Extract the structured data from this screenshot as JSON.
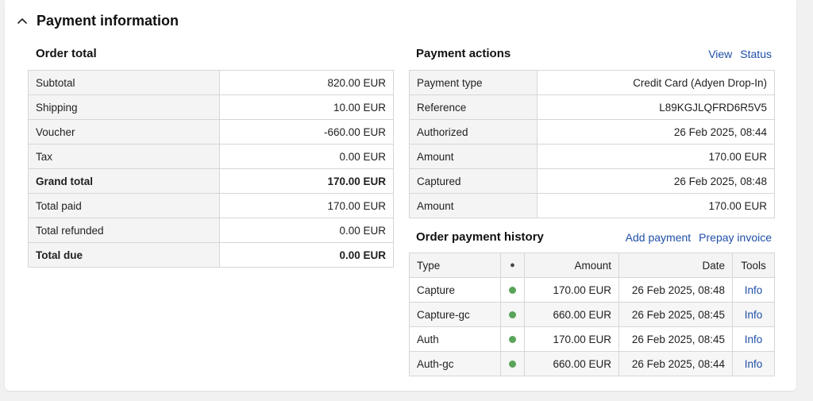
{
  "section": {
    "title": "Payment information",
    "header_dot": "●"
  },
  "order_total": {
    "title": "Order total",
    "rows": [
      {
        "label": "Subtotal",
        "value": "820.00 EUR",
        "bold": false
      },
      {
        "label": "Shipping",
        "value": "10.00 EUR",
        "bold": false
      },
      {
        "label": "Voucher",
        "value": "-660.00 EUR",
        "bold": false
      },
      {
        "label": "Tax",
        "value": "0.00 EUR",
        "bold": false
      },
      {
        "label": "Grand total",
        "value": "170.00 EUR",
        "bold": true
      },
      {
        "label": "Total paid",
        "value": "170.00 EUR",
        "bold": false
      },
      {
        "label": "Total refunded",
        "value": "0.00 EUR",
        "bold": false
      },
      {
        "label": "Total due",
        "value": "0.00 EUR",
        "bold": true
      }
    ]
  },
  "payment_actions": {
    "title": "Payment actions",
    "links": [
      "View",
      "Status"
    ],
    "rows": [
      {
        "label": "Payment type",
        "value": "Credit Card (Adyen Drop-In)"
      },
      {
        "label": "Reference",
        "value": "L89KGJLQFRD6R5V5"
      },
      {
        "label": "Authorized",
        "value": "26 Feb 2025, 08:44"
      },
      {
        "label": "Amount",
        "value": "170.00 EUR"
      },
      {
        "label": "Captured",
        "value": "26 Feb 2025, 08:48"
      },
      {
        "label": "Amount",
        "value": "170.00 EUR"
      }
    ]
  },
  "payment_history": {
    "title": "Order payment history",
    "links": [
      "Add payment",
      "Prepay invoice"
    ],
    "columns": {
      "type": "Type",
      "status": "●",
      "amount": "Amount",
      "date": "Date",
      "tools": "Tools"
    },
    "rows": [
      {
        "type": "Capture",
        "amount": "170.00 EUR",
        "date": "26 Feb 2025, 08:48",
        "tool": "Info"
      },
      {
        "type": "Capture-gc",
        "amount": "660.00 EUR",
        "date": "26 Feb 2025, 08:45",
        "tool": "Info"
      },
      {
        "type": "Auth",
        "amount": "170.00 EUR",
        "date": "26 Feb 2025, 08:45",
        "tool": "Info"
      },
      {
        "type": "Auth-gc",
        "amount": "660.00 EUR",
        "date": "26 Feb 2025, 08:44",
        "tool": "Info"
      }
    ]
  },
  "colors": {
    "status_success": "#5aa45a",
    "link": "#1f4fa8",
    "header_dot": "#444444"
  },
  "icons": {
    "collapse": "chevron-up-icon",
    "status": "status-dot-icon"
  }
}
